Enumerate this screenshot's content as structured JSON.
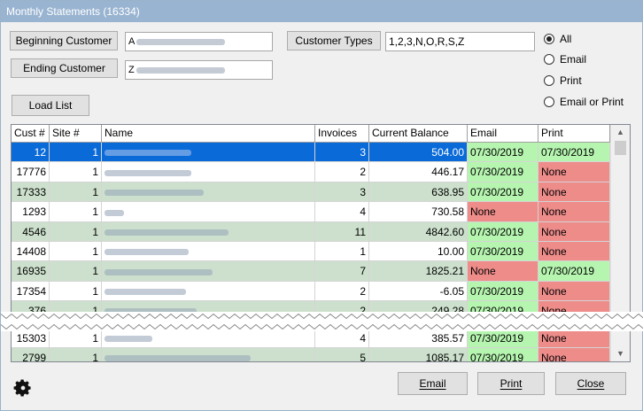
{
  "window": {
    "title": "Monthly Statements (16334)"
  },
  "buttons": {
    "beginning_customer": "Beginning Customer",
    "ending_customer": "Ending Customer",
    "customer_types": "Customer Types",
    "load_list": "Load List",
    "email": "Email",
    "print": "Print",
    "close": "Close"
  },
  "fields": {
    "beginning_customer_value": "A",
    "ending_customer_value": "Z",
    "customer_types_value": "1,2,3,N,O,R,S,Z"
  },
  "radios": [
    {
      "label": "All",
      "selected": true
    },
    {
      "label": "Email",
      "selected": false
    },
    {
      "label": "Print",
      "selected": false
    },
    {
      "label": "Email or Print",
      "selected": false
    }
  ],
  "table": {
    "columns": [
      "Cust #",
      "Site #",
      "Name",
      "Invoices",
      "Current Balance",
      "Email",
      "Print"
    ],
    "rows": [
      {
        "cust": "12",
        "site": "1",
        "invoices": "3",
        "balance": "504.00",
        "email": "07/30/2019",
        "print": "07/30/2019"
      },
      {
        "cust": "17776",
        "site": "1",
        "invoices": "2",
        "balance": "446.17",
        "email": "07/30/2019",
        "print": "None"
      },
      {
        "cust": "17333",
        "site": "1",
        "invoices": "3",
        "balance": "638.95",
        "email": "07/30/2019",
        "print": "None"
      },
      {
        "cust": "1293",
        "site": "1",
        "invoices": "4",
        "balance": "730.58",
        "email": "None",
        "print": "None"
      },
      {
        "cust": "4546",
        "site": "1",
        "invoices": "11",
        "balance": "4842.60",
        "email": "07/30/2019",
        "print": "None"
      },
      {
        "cust": "14408",
        "site": "1",
        "invoices": "1",
        "balance": "10.00",
        "email": "07/30/2019",
        "print": "None"
      },
      {
        "cust": "16935",
        "site": "1",
        "invoices": "7",
        "balance": "1825.21",
        "email": "None",
        "print": "07/30/2019"
      },
      {
        "cust": "17354",
        "site": "1",
        "invoices": "2",
        "balance": "-6.05",
        "email": "07/30/2019",
        "print": "None"
      },
      {
        "cust": "376",
        "site": "1",
        "invoices": "2",
        "balance": "249.28",
        "email": "07/30/2019",
        "print": "None"
      },
      {
        "cust": "15303",
        "site": "1",
        "invoices": "4",
        "balance": "385.57",
        "email": "07/30/2019",
        "print": "None"
      },
      {
        "cust": "2799",
        "site": "1",
        "invoices": "5",
        "balance": "1085.17",
        "email": "07/30/2019",
        "print": "None"
      }
    ]
  },
  "colors": {
    "titlebar": "#99b4d1",
    "selected_row": "#0a6ad8",
    "alt_row": "#cde0cd",
    "date_cell": "#b6f5b0",
    "none_cell": "#ee8c8a"
  }
}
